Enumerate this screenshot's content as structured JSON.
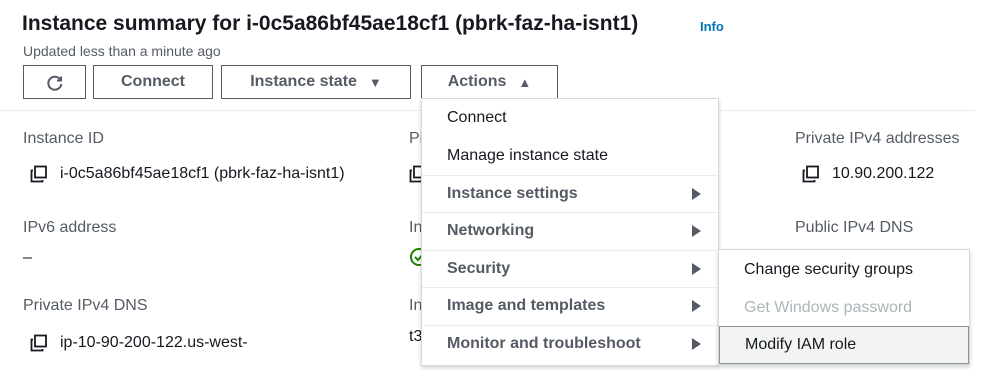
{
  "header": {
    "title": "Instance summary for i-0c5a86bf45ae18cf1 (pbrk-faz-ha-isnt1)",
    "info_link": "Info",
    "updated": "Updated less than a minute ago"
  },
  "toolbar": {
    "connect_label": "Connect",
    "instance_state_label": "Instance state",
    "actions_label": "Actions"
  },
  "details": {
    "instance_id_label": "Instance ID",
    "instance_id_value": "i-0c5a86bf45ae18cf1 (pbrk-faz-ha-isnt1)",
    "ipv6_label": "IPv6 address",
    "ipv6_value": "–",
    "private_dns_label": "Private IPv4 DNS",
    "private_dns_value": "ip-10-90-200-122.us-west-",
    "private_ipv4_label": "Private IPv4 addresses",
    "private_ipv4_value": "10.90.200.122",
    "public_dns_label": "Public IPv4 DNS",
    "col2_partial_1": "Pi",
    "col2_partial_2": "In",
    "col2_partial_3": "In",
    "col2_partial_4": "t3"
  },
  "actions_menu": {
    "items": [
      {
        "label": "Connect"
      },
      {
        "label": "Manage instance state"
      },
      {
        "label": "Instance settings"
      },
      {
        "label": "Networking"
      },
      {
        "label": "Security"
      },
      {
        "label": "Image and templates"
      },
      {
        "label": "Monitor and troubleshoot"
      }
    ]
  },
  "security_submenu": {
    "items": [
      {
        "label": "Change security groups"
      },
      {
        "label": "Get Windows password"
      },
      {
        "label": "Modify IAM role"
      }
    ]
  },
  "colors": {
    "text": "#16191f",
    "secondary": "#545b64",
    "link": "#0073bb",
    "success": "#1d8102",
    "disabled": "#aab7b8"
  },
  "icons": [
    "refresh-icon",
    "caret-down-icon",
    "caret-up-icon",
    "copy-icon",
    "status-check-icon",
    "submenu-arrow-icon"
  ]
}
